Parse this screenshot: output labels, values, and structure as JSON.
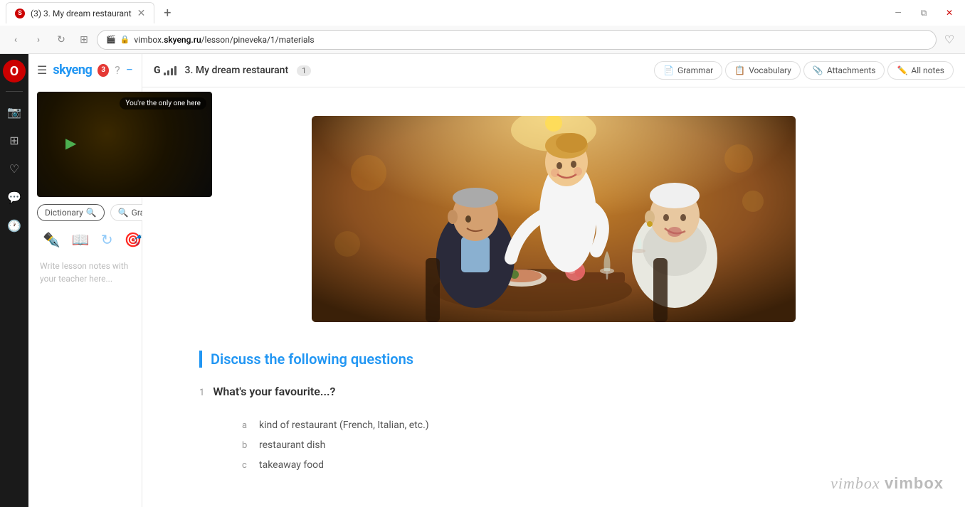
{
  "browser": {
    "tab_label": "(3) 3. My dream restaurant",
    "url_domain": "vimbox.skyeng.ru",
    "url_path": "/lesson/pineveka/1/materials",
    "url_display": "vimbox.skyeng.ru/lesson/pineveka/1/materials"
  },
  "topbar": {
    "signal_letter": "G",
    "lesson_title": "3. My dream restaurant",
    "lesson_badge": "1",
    "nav_pills": [
      {
        "id": "grammar",
        "label": "Grammar",
        "icon": "📄"
      },
      {
        "id": "vocabulary",
        "label": "Vocabulary",
        "icon": "📋"
      },
      {
        "id": "attachments",
        "label": "Attachments",
        "icon": "📎"
      },
      {
        "id": "all-notes",
        "label": "All notes",
        "icon": "✏️"
      }
    ]
  },
  "sidebar": {
    "logo": "skyeng",
    "notification_count": "3",
    "video_overlay": "You're the only one here"
  },
  "dict_tabs": [
    {
      "id": "dictionary",
      "label": "Dictionary",
      "active": true
    },
    {
      "id": "grammar",
      "label": "Grammar",
      "active": false
    }
  ],
  "notes_placeholder": "Write lesson notes with your teacher here...",
  "discussion": {
    "title": "Discuss the following questions",
    "question_number": "1",
    "question_text": "What's your favourite...?",
    "sub_questions": [
      {
        "letter": "a",
        "text": "kind of restaurant (French, Italian, etc.)"
      },
      {
        "letter": "b",
        "text": "restaurant dish"
      },
      {
        "letter": "c",
        "text": "takeaway food"
      }
    ]
  },
  "watermark": "vimbox"
}
